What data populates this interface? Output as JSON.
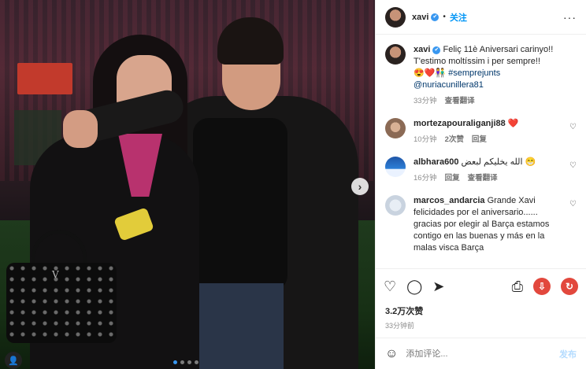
{
  "header": {
    "username": "xavi",
    "verified_mark": "✔",
    "separator": "•",
    "follow_label": "关注",
    "more_icon": "···"
  },
  "caption": {
    "username": "xavi",
    "text_line1": "Feliç 11è Aniversari carinyo!!",
    "text_line2": "T'estimo moltíssim i per sempre!!",
    "emojis": "😍❤️👫",
    "hashtag": "#semprejunts",
    "mention": "@nuriacunillera81",
    "time": "33分钟",
    "translate": "查看翻译"
  },
  "comments": [
    {
      "username": "mortezapouraliganji88",
      "text": "❤️",
      "time": "10分钟",
      "likes": "2次赞",
      "reply": "回复"
    },
    {
      "username": "albhara600",
      "text": "الله يخليكم لبعض 😁",
      "time": "16分钟",
      "reply": "回复",
      "translate": "查看翻译"
    },
    {
      "username": "marcos_andarcia",
      "text": "Grande Xavi felicidades por el aniversario...... gracias por elegir al Barça estamos contigo en las buenas y más en la malas visca Barça"
    }
  ],
  "actions": {
    "like_icon": "♡",
    "comment_icon": "◯",
    "share_icon": "➤",
    "save_icon": "⎙",
    "download_icon": "⇩",
    "refresh_icon": "↻"
  },
  "likes_count": "3.2万次赞",
  "post_time": "33分钟前",
  "add_comment": {
    "emoji_icon": "☺",
    "placeholder": "添加评论...",
    "post_label": "发布"
  },
  "photo": {
    "next_icon": "›",
    "carousel_total": 4,
    "carousel_active": 1,
    "tag_icon": "👤"
  },
  "colors": {
    "accent": "#0095f6",
    "verified": "#3897f0",
    "heart_red": "#e0245e"
  }
}
